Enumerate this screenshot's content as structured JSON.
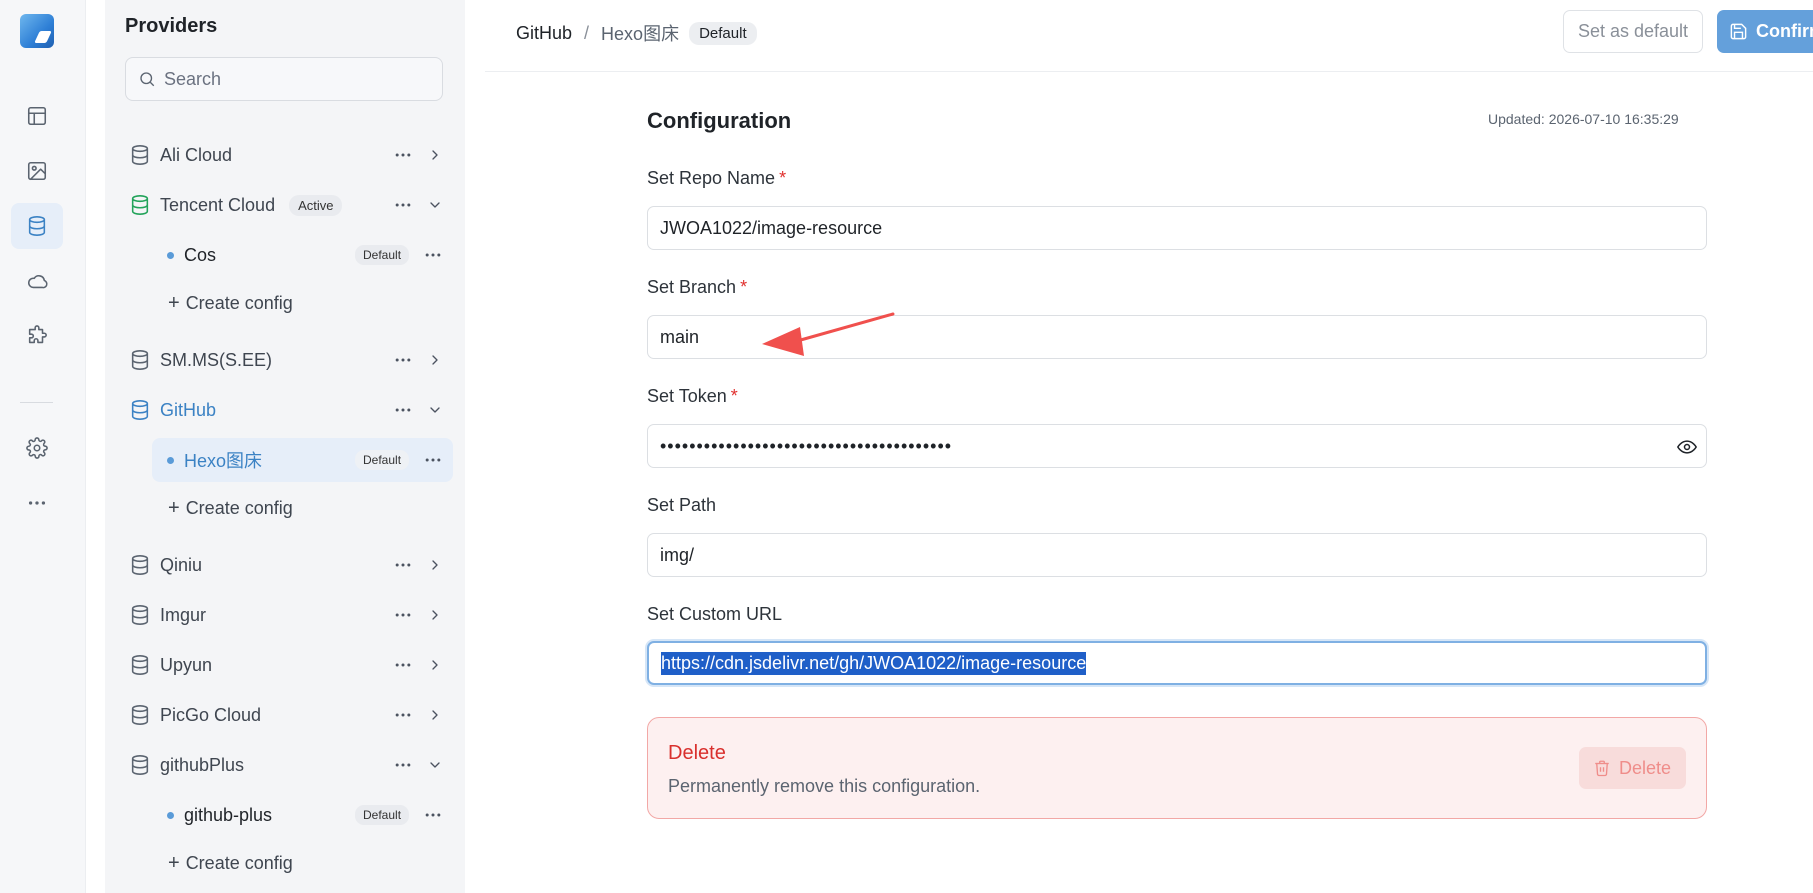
{
  "providers_panel": {
    "title": "Providers",
    "search_placeholder": "Search",
    "providers": [
      {
        "name": "Ali Cloud"
      },
      {
        "name": "Tencent Cloud",
        "badge": "Active",
        "configs": [
          {
            "name": "Cos",
            "badge": "Default"
          }
        ],
        "create_label": "Create config"
      },
      {
        "name": "SM.MS(S.EE)"
      },
      {
        "name": "GitHub",
        "configs": [
          {
            "name": "Hexo图床",
            "badge": "Default"
          }
        ],
        "create_label": "Create config"
      },
      {
        "name": "Qiniu"
      },
      {
        "name": "Imgur"
      },
      {
        "name": "Upyun"
      },
      {
        "name": "PicGo Cloud"
      },
      {
        "name": "githubPlus",
        "configs": [
          {
            "name": "github-plus",
            "badge": "Default"
          }
        ],
        "create_label": "Create config"
      }
    ]
  },
  "breadcrumb": {
    "provider": "GitHub",
    "separator": "/",
    "config": "Hexo图床",
    "badge": "Default"
  },
  "toolbar": {
    "set_default_label": "Set as default",
    "confirm_label": "Confirm"
  },
  "config": {
    "title": "Configuration",
    "updated": "Updated: 2026-07-10 16:35:29",
    "fields": {
      "repo": {
        "label": "Set Repo Name",
        "required": "*",
        "value": "JWOA1022/image-resource"
      },
      "branch": {
        "label": "Set Branch",
        "required": "*",
        "value": "main"
      },
      "token": {
        "label": "Set Token",
        "required": "*",
        "value": "••••••••••••••••••••••••••••••••••••••••"
      },
      "path": {
        "label": "Set Path",
        "value": "img/"
      },
      "custom_url": {
        "label": "Set Custom URL",
        "value": "https://cdn.jsdelivr.net/gh/JWOA1022/image-resource"
      }
    }
  },
  "danger": {
    "title": "Delete",
    "description": "Permanently remove this configuration.",
    "button_label": "Delete"
  },
  "colors": {
    "accent": "#3b82c4",
    "active_green": "#22a35a",
    "danger": "#d9302d",
    "annotation_arrow": "#f0504d"
  }
}
